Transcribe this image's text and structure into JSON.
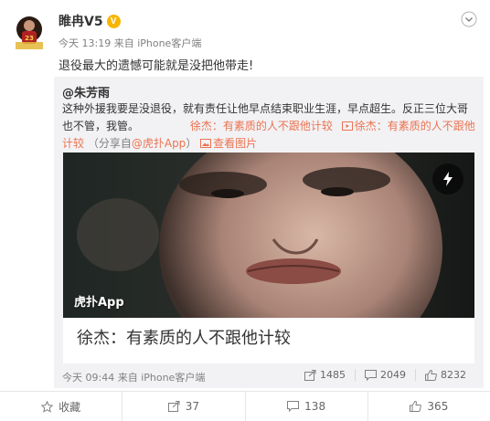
{
  "post": {
    "username": "睢冉V5",
    "badge": "V",
    "meta": "今天 13:19 来自 iPhone客户端",
    "text": "退役最大的遗憾可能就是没把他带走!"
  },
  "quote": {
    "author": "@朱芳雨",
    "text_main": "这种外援我要是没退役，就有责任让他早点结束职业生涯，早点超生。反正三位大哥也不管，我管。",
    "text_link": "徐杰：有素质的人不跟他计较",
    "video_link": "徐杰：有素质的人不跟他计较",
    "share_note": "（分享自",
    "share_app": "@虎扑App",
    "share_close": "）",
    "view_image": "查看图片",
    "video": {
      "logo": "虎扑App",
      "title": "徐杰：有素质的人不跟他计较"
    },
    "meta": "今天 09:44 来自 iPhone客户端",
    "stats": {
      "repost": "1485",
      "comment": "2049",
      "like": "8232"
    }
  },
  "actions": {
    "favorite": "收藏",
    "repost": "37",
    "comment": "138",
    "like": "365"
  },
  "colors": {
    "link": "#eb7350",
    "badge": "#f7b500",
    "quote_bg": "#f2f2f5"
  }
}
